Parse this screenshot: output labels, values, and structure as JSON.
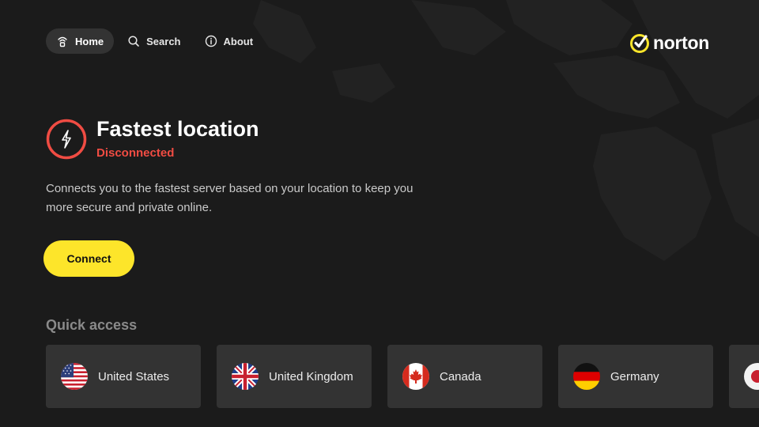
{
  "nav": {
    "items": [
      {
        "label": "Home",
        "icon": "home-icon",
        "active": true
      },
      {
        "label": "Search",
        "icon": "search-icon",
        "active": false
      },
      {
        "label": "About",
        "icon": "info-icon",
        "active": false
      }
    ]
  },
  "brand": {
    "name": "norton",
    "accent": "#fde52a"
  },
  "hero": {
    "title": "Fastest location",
    "status": "Disconnected",
    "status_color": "#f04c43",
    "icon": "lightning-icon",
    "description": "Connects you to the fastest server based on your location to keep you more secure and private online.",
    "connect_label": "Connect"
  },
  "quick_access": {
    "title": "Quick access",
    "items": [
      {
        "label": "United States",
        "flag": "us-flag-icon"
      },
      {
        "label": "United Kingdom",
        "flag": "uk-flag-icon"
      },
      {
        "label": "Canada",
        "flag": "canada-flag-icon"
      },
      {
        "label": "Germany",
        "flag": "germany-flag-icon"
      },
      {
        "label": "",
        "flag": "japan-flag-icon"
      }
    ]
  }
}
